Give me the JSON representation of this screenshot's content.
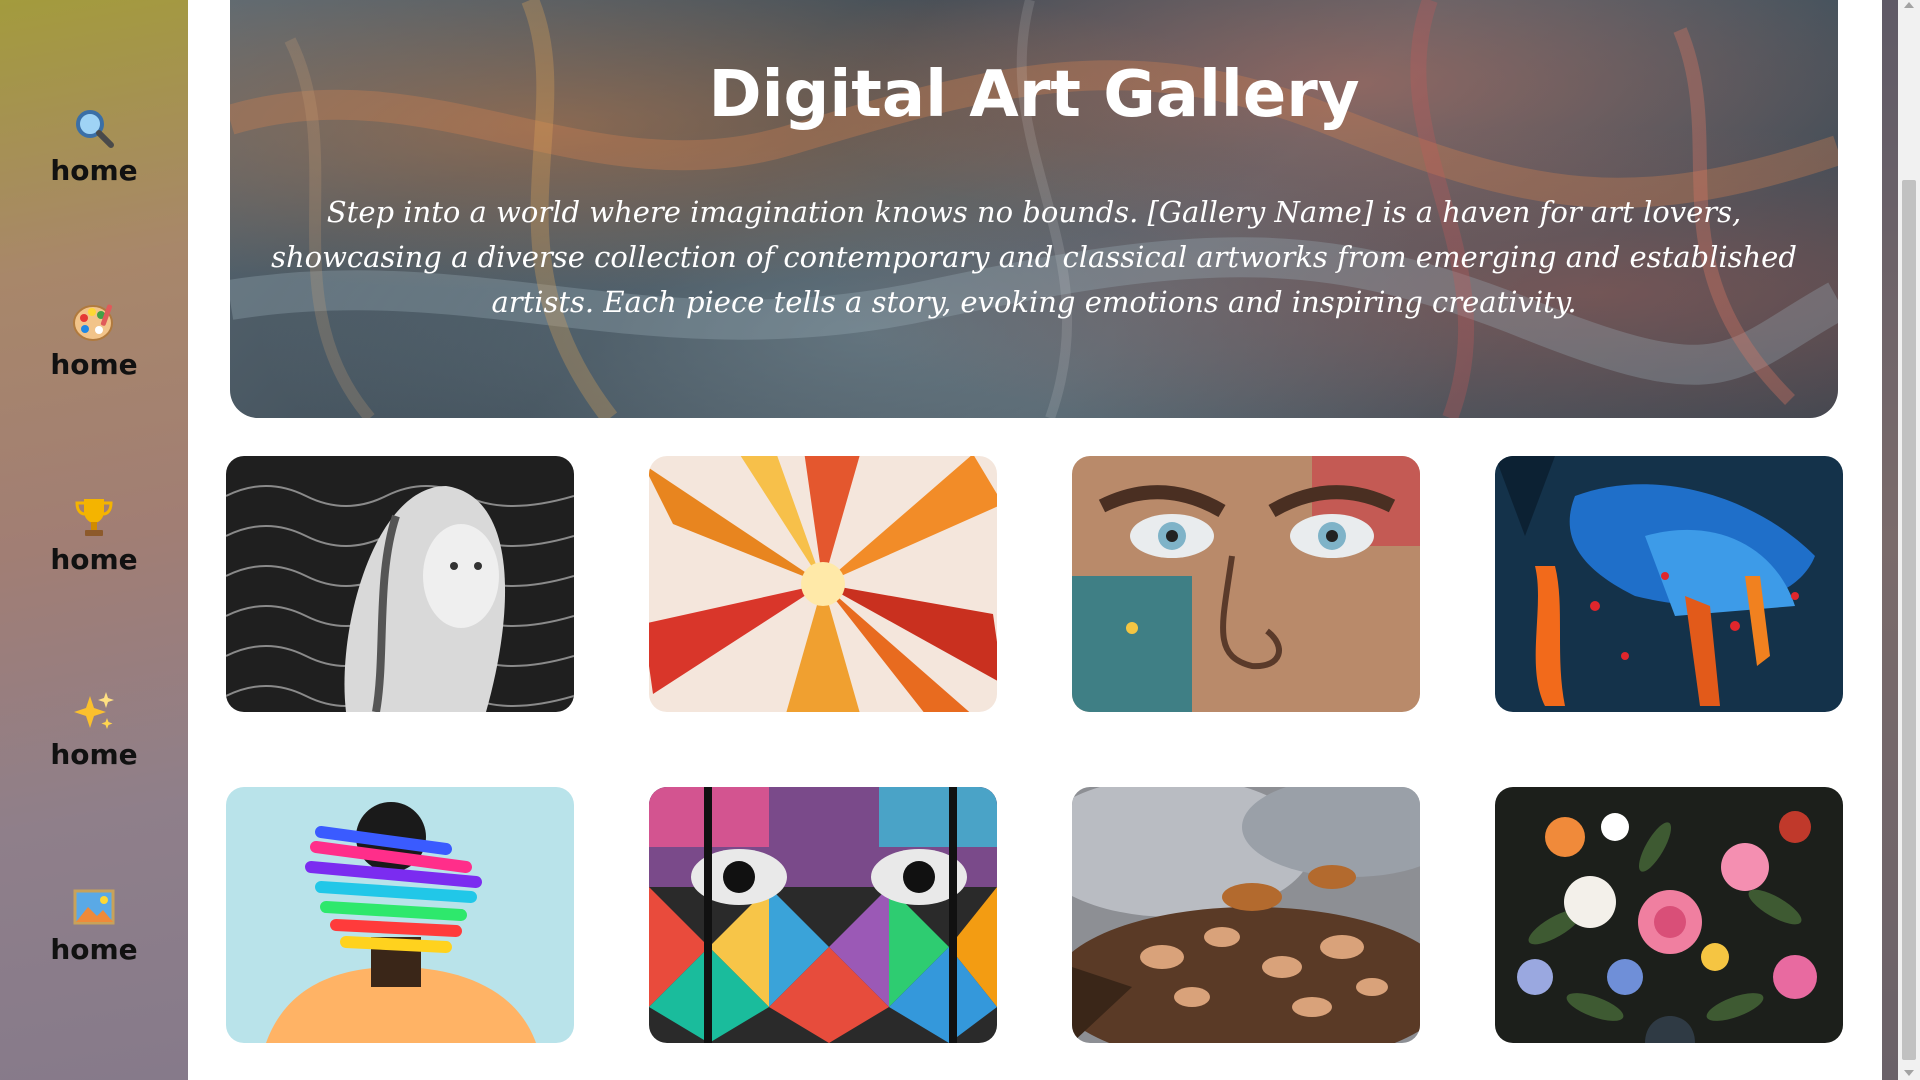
{
  "sidebar": {
    "items": [
      {
        "icon": "search-icon",
        "label": "home"
      },
      {
        "icon": "palette-icon",
        "label": "home"
      },
      {
        "icon": "trophy-icon",
        "label": "home"
      },
      {
        "icon": "sparkles-icon",
        "label": "home"
      },
      {
        "icon": "picture-icon",
        "label": "home"
      }
    ]
  },
  "hero": {
    "title": "Digital Art Gallery",
    "description": "Step into a world where imagination knows no bounds. [Gallery Name] is a haven for art lovers, showcasing a diverse collection of contemporary and classical artworks from emerging and established artists. Each piece tells a story, evoking emotions and inspiring creativity."
  },
  "gallery": {
    "tiles": [
      {
        "name": "sketch-woman-artwork"
      },
      {
        "name": "orange-fluid-burst-artwork"
      },
      {
        "name": "graffiti-face-artwork"
      },
      {
        "name": "blue-abstract-paint-artwork"
      },
      {
        "name": "brushstroke-portrait-artwork"
      },
      {
        "name": "mosaic-face-mural-artwork"
      },
      {
        "name": "baroque-ceiling-artwork"
      },
      {
        "name": "flower-still-life-artwork"
      }
    ]
  },
  "colors": {
    "sidebar_top": "#a39b3d",
    "sidebar_bottom": "#867a8a",
    "hero_text": "#ffffff",
    "nav_label": "#111111"
  }
}
